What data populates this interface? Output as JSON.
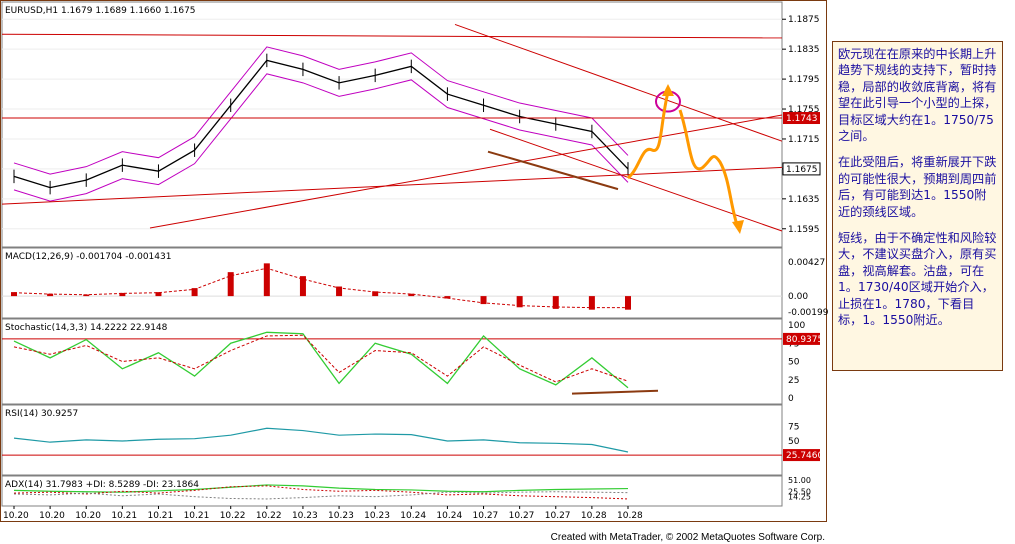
{
  "chart_data": {
    "type": "line",
    "symbol_header": "EURUSD,H1  1.1679 1.1689 1.1660 1.1675",
    "price_axis_ticks": [
      "1.1875",
      "1.1835",
      "1.1795",
      "1.1755",
      "1.1715",
      "1.1675",
      "1.1635",
      "1.1595"
    ],
    "price_ylim": [
      1.158,
      1.189
    ],
    "last_price_label": "1.1675",
    "resistance_label": "1.1743",
    "dates": [
      "10.20",
      "10.20",
      "10.20",
      "10.21",
      "10.21",
      "10.21",
      "10.22",
      "10.22",
      "10.23",
      "10.23",
      "10.23",
      "10.24",
      "10.24",
      "10.27",
      "10.27",
      "10.27",
      "10.28",
      "10.28"
    ],
    "close_series": [
      1.1665,
      1.165,
      1.166,
      1.168,
      1.1672,
      1.17,
      1.176,
      1.182,
      1.1808,
      1.179,
      1.18,
      1.1812,
      1.1775,
      1.176,
      1.1745,
      1.1735,
      1.1725,
      1.1675
    ],
    "macd": {
      "label": "MACD(12,26,9)  -0.001704  -0.001431",
      "ticks": [
        "0.00427",
        "0.00",
        "-0.00199"
      ],
      "ylim": [
        -0.00199,
        0.00427
      ],
      "values": [
        0.0005,
        0.0003,
        0.0002,
        0.0004,
        0.0005,
        0.001,
        0.003,
        0.0041,
        0.0025,
        0.0012,
        0.0006,
        0.0003,
        -0.0003,
        -0.001,
        -0.0014,
        -0.0016,
        -0.0017,
        -0.0017
      ]
    },
    "stochastic": {
      "label": "Stochastic(14,3,3)  14.2222  22.9148",
      "ticks": [
        "100",
        "75",
        "50",
        "25",
        "0"
      ],
      "overbought_label": "80.9375",
      "ylim": [
        0,
        100
      ],
      "k": [
        78,
        55,
        80,
        40,
        62,
        30,
        75,
        90,
        88,
        20,
        75,
        60,
        20,
        85,
        40,
        18,
        55,
        14
      ],
      "d": [
        70,
        60,
        72,
        50,
        55,
        40,
        65,
        85,
        86,
        35,
        65,
        62,
        30,
        70,
        45,
        22,
        40,
        23
      ]
    },
    "rsi": {
      "label": "RSI(14)  30.9257",
      "ticks": [
        "75",
        "50",
        "25"
      ],
      "level_label": "25.7460",
      "ylim": [
        0,
        100
      ],
      "values": [
        55,
        48,
        52,
        50,
        53,
        54,
        60,
        72,
        68,
        60,
        62,
        61,
        50,
        52,
        47,
        46,
        44,
        31
      ]
    },
    "adx": {
      "label": "ADX(14)  31.7983  +DI: 8.5289  -DI: 23.1864",
      "ticks": [
        "51.00",
        "25.50",
        "14.25"
      ],
      "ylim": [
        0,
        51
      ],
      "adx": [
        28,
        26,
        25,
        24,
        27,
        30,
        35,
        40,
        38,
        33,
        30,
        29,
        26,
        25,
        28,
        30,
        31,
        32
      ],
      "plus_di": [
        22,
        24,
        20,
        26,
        22,
        28,
        36,
        38,
        30,
        26,
        28,
        24,
        18,
        20,
        16,
        14,
        12,
        9
      ],
      "minus_di": [
        20,
        18,
        22,
        16,
        20,
        14,
        10,
        9,
        12,
        16,
        14,
        18,
        24,
        22,
        24,
        25,
        24,
        23
      ]
    }
  },
  "annotation": {
    "para1": "欧元现在在原来的中长期上升趋势下规线的支持下，暂时持稳，局部的收敛底背离，将有望在此引导一个小型的上探，目标区域大约在1。1750/75之间。",
    "para2": "在此受阻后，将重新展开下跌的可能性很大，预期到周四前后，有可能到达1。1550附近的颈线区域。",
    "para3": "短线，由于不确定性和风险较大，不建议买盘介入，原有买盘，视高解套。沽盘，可在1。1730/40区域开始介入，止损在1。1780，下看目标，1。1550附近。"
  },
  "footer": "Created with MetaTrader, © 2002 MetaQuotes Software Corp.",
  "colors": {
    "price": "#000000",
    "bollinger": "#c000c0",
    "trendline": "#cc0000",
    "projection": "#ff9900",
    "macd_hist": "#cc0000",
    "stoch_k": "#33cc33",
    "stoch_d": "#cc0000",
    "rsi": "#1f9aa6",
    "adx_main": "#33cc33",
    "note_text": "#1a0ea0"
  }
}
